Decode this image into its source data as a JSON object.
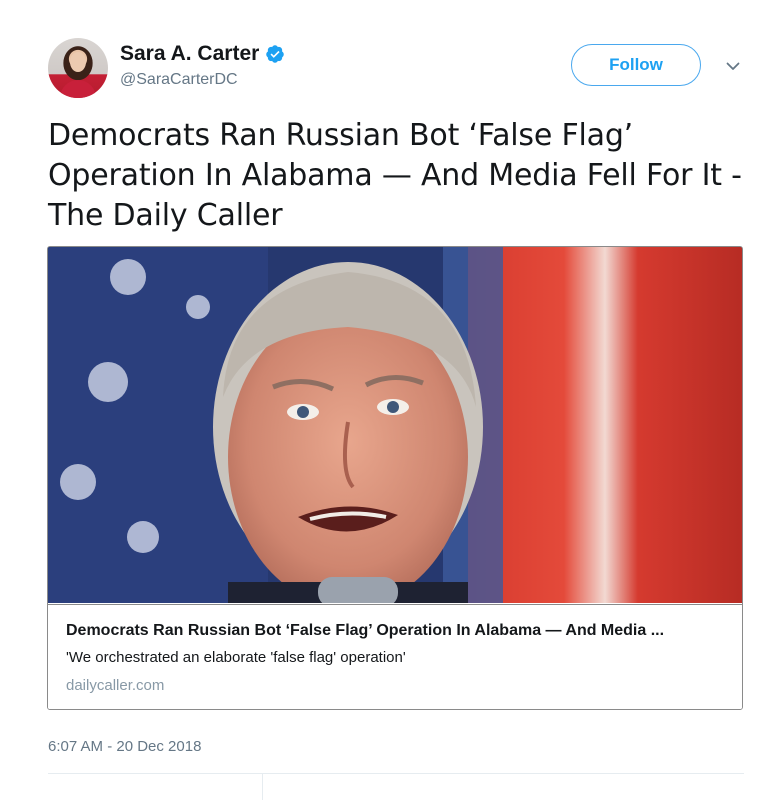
{
  "tweet": {
    "author": {
      "display_name": "Sara A. Carter",
      "handle": "@SaraCarterDC",
      "verified": true,
      "avatar_icon": "profile-photo"
    },
    "follow_label": "Follow",
    "caret_icon": "chevron-down-icon",
    "text": "Democrats Ran Russian Bot ‘False Flag’ Operation In Alabama — And Media Fell For It - The Daily Caller",
    "card": {
      "title": "Democrats Ran Russian Bot ‘False Flag’ Operation In Alabama — And Media ...",
      "description": "'We orchestrated an elaborate 'false flag' operation'",
      "domain": "dailycaller.com"
    },
    "timestamp": "6:07 AM - 20 Dec 2018"
  },
  "colors": {
    "accent": "#1da1f2",
    "follow_border": "#4aa8ee",
    "muted_text": "#657786",
    "domain_text": "#8899a6",
    "verified_badge": "#1da1f2"
  }
}
